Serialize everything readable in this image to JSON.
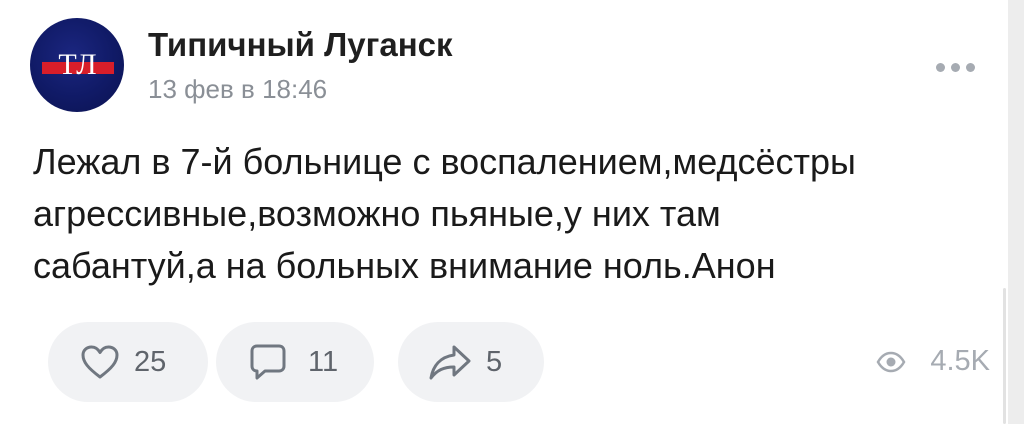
{
  "post": {
    "author": "Типичный Луганск",
    "date": "13 фев в 18:46",
    "avatar_text": "ТЛ",
    "text": "Лежал в 7-й больнице с воспалением,медсёстры\nагрессивные,возможно пьяные,у них там\nсабантуй,а на больных внимание ноль.Анон"
  },
  "actions": {
    "likes": "25",
    "comments": "11",
    "shares": "5",
    "views": "4.5K"
  },
  "icons": {
    "like": "heart-icon",
    "comment": "speech-bubble-icon",
    "share": "share-arrow-icon",
    "views": "eye-icon",
    "more": "more-dots-icon"
  },
  "colors": {
    "avatar_bg": "#101a66",
    "avatar_accent": "#d81e2a",
    "pill_bg": "#f1f2f4",
    "icon_gray": "#707780",
    "muted_text": "#8a8f96"
  }
}
